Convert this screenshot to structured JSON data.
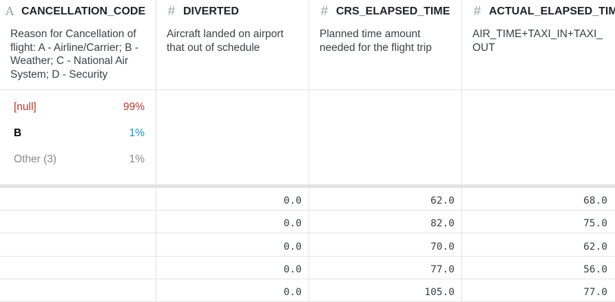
{
  "columns": [
    {
      "type_icon": "A",
      "name": "CANCELLATION_CODE",
      "description": "Reason for Cancellation of flight: A - Airline/Carrier; B - Weather; C - National Air System; D - Security",
      "summary": [
        {
          "label": "[null]",
          "pct": "99%"
        },
        {
          "label": "B",
          "pct": "1%"
        },
        {
          "label": "Other (3)",
          "pct": "1%"
        }
      ],
      "values": [
        "",
        "",
        "",
        "",
        ""
      ]
    },
    {
      "type_icon": "#",
      "name": "DIVERTED",
      "description": "Aircraft landed on airport that out of schedule",
      "values": [
        "0.0",
        "0.0",
        "0.0",
        "0.0",
        "0.0"
      ]
    },
    {
      "type_icon": "#",
      "name": "CRS_ELAPSED_TIME",
      "description": "Planned time amount needed for the flight trip",
      "values": [
        "62.0",
        "82.0",
        "70.0",
        "77.0",
        "105.0"
      ]
    },
    {
      "type_icon": "#",
      "name": "ACTUAL_ELAPSED_TIME",
      "description": "AIR_TIME+TAXI_IN+TAXI_OUT",
      "values": [
        "68.0",
        "75.0",
        "62.0",
        "56.0",
        "77.0"
      ]
    }
  ],
  "colors": {
    "null_label": "#b03a2e",
    "bar_blue": "#1b8fc1",
    "divider": "#e3e3e3"
  }
}
